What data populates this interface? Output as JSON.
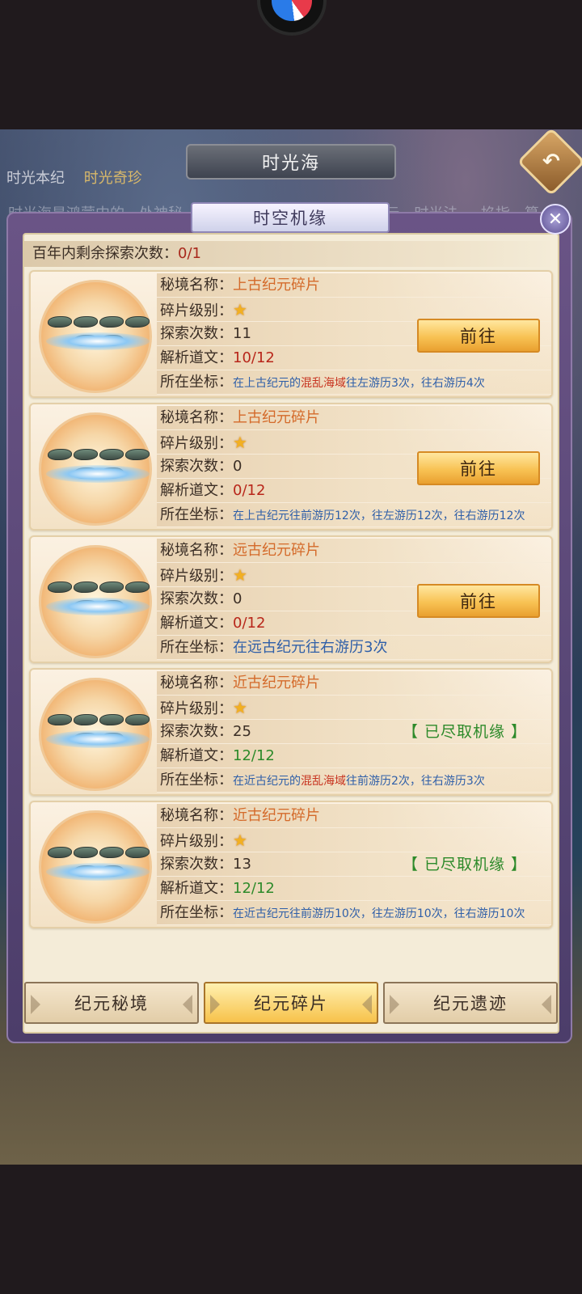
{
  "scene": {
    "title": "时光海",
    "tabs": [
      "时光本纪",
      "时光奇珍"
    ],
    "bg_text": "时光海是鸿蒙中的一处神秘 ... 落的一角起源，谁曾 诸天纪元，时光法 ... 掐指一算"
  },
  "dialog": {
    "title": "时空机缘",
    "remaining_label": "百年内剩余探索次数：",
    "remaining_value": "0/1"
  },
  "labels": {
    "name": "秘境名称：",
    "level": "碎片级别：",
    "explore": "探索次数：",
    "decode": "解析道文：",
    "coord": "所在坐标："
  },
  "cards": [
    {
      "name": "上古纪元碎片",
      "stars": "★",
      "explore": "11",
      "decode": "10/12",
      "coord_pre": "在上古纪元的",
      "coord_hl": "混乱海域",
      "coord_post": "往左游历3次，往右游历4次",
      "action": "前往"
    },
    {
      "name": "上古纪元碎片",
      "stars": "★",
      "explore": "0",
      "decode": "0/12",
      "coord_pre": "在上古纪元往前游历12次，往左游历12次，往右游历12次",
      "coord_hl": "",
      "coord_post": "",
      "action": "前往"
    },
    {
      "name": "远古纪元碎片",
      "stars": "★",
      "explore": "0",
      "decode": "0/12",
      "coord_pre": "在远古纪元往右游历3次",
      "coord_hl": "",
      "coord_post": "",
      "action": "前往"
    },
    {
      "name": "近古纪元碎片",
      "stars": "★",
      "explore": "25",
      "decode": "12/12",
      "coord_pre": "在近古纪元的",
      "coord_hl": "混乱海域",
      "coord_post": "往前游历2次，往右游历3次",
      "status": "【 已尽取机缘 】"
    },
    {
      "name": "近古纪元碎片",
      "stars": "★",
      "explore": "13",
      "decode": "12/12",
      "coord_pre": "在近古纪元往前游历10次，往左游历10次，往右游历10次",
      "coord_hl": "",
      "coord_post": "",
      "status": "【 已尽取机缘 】"
    }
  ],
  "bottom_tabs": [
    {
      "label": "纪元秘境",
      "active": false
    },
    {
      "label": "纪元碎片",
      "active": true
    },
    {
      "label": "纪元遗迹",
      "active": false
    }
  ],
  "icons": {
    "close": "close-icon",
    "back": "back-arrow-icon",
    "star": "star-icon"
  },
  "colors": {
    "accent": "#f8c253",
    "name": "#d46a2a",
    "red": "#b8261a",
    "green": "#2d8a2a",
    "coord": "#2f5fa8"
  }
}
